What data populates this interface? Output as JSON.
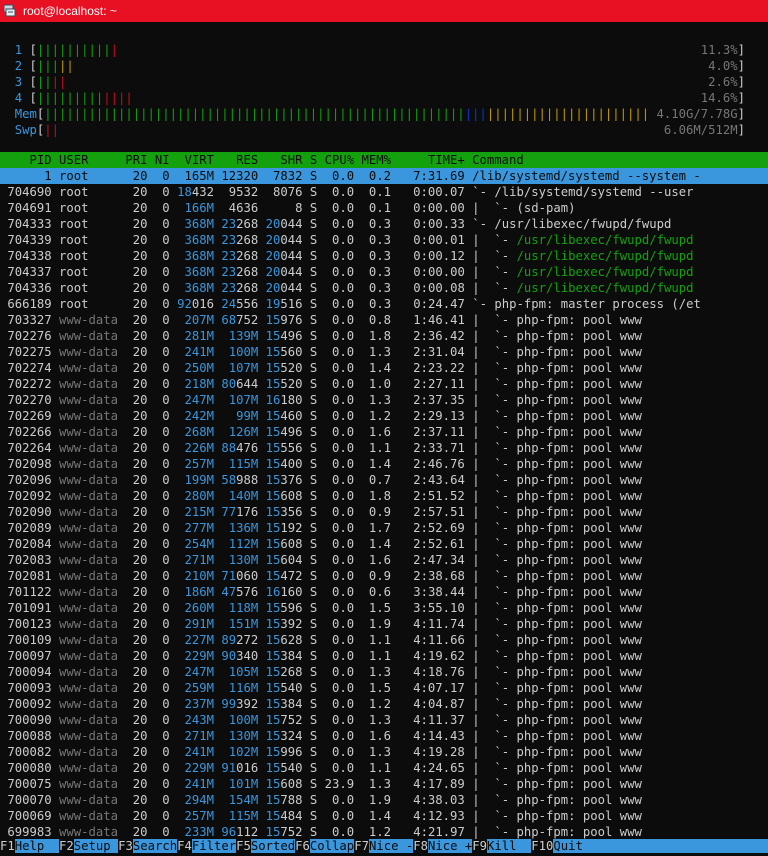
{
  "window": {
    "title": "root@localhost: ~"
  },
  "cpu_meters": [
    {
      "id": "1",
      "pct": "11.3%",
      "segs": [
        [
          "green",
          "||||||||||"
        ],
        [
          "red",
          "|"
        ]
      ]
    },
    {
      "id": "2",
      "pct": "4.0%",
      "segs": [
        [
          "green",
          "|||"
        ],
        [
          "yellow",
          "||"
        ]
      ]
    },
    {
      "id": "3",
      "pct": "2.6%",
      "segs": [
        [
          "green",
          "||"
        ],
        [
          "red",
          "||"
        ]
      ]
    },
    {
      "id": "4",
      "pct": "14.6%",
      "segs": [
        [
          "green",
          "|||||||||"
        ],
        [
          "red",
          "||||"
        ]
      ]
    }
  ],
  "mem_meter": {
    "label": "Mem",
    "value": "4.10G/7.78G"
  },
  "swp_meter": {
    "label": "Swp",
    "value": "6.06M/512M"
  },
  "columns": [
    "PID",
    "USER",
    "PRI",
    "NI",
    "VIRT",
    "RES",
    "SHR",
    "S",
    "CPU%",
    "MEM%",
    "TIME+",
    "Command"
  ],
  "processes": [
    {
      "pid": "1",
      "user": "root",
      "pri": "20",
      "ni": "0",
      "virt": "165M",
      "res": "12320",
      "shr": "7832",
      "s": "S",
      "cpu": "0.0",
      "mem": "0.2",
      "time": "7:31.69",
      "cmd": "/lib/systemd/systemd --system -"
    },
    {
      "pid": "704690",
      "user": "root",
      "pri": "20",
      "ni": "0",
      "virt": "18432",
      "res": "9532",
      "shr": "8076",
      "s": "S",
      "cpu": "0.0",
      "mem": "0.1",
      "time": "0:00.07",
      "cmd": "`- /lib/systemd/systemd --user"
    },
    {
      "pid": "704691",
      "user": "root",
      "pri": "20",
      "ni": "0",
      "virt": "166M",
      "res": "4636",
      "shr": "8",
      "s": "S",
      "cpu": "0.0",
      "mem": "0.1",
      "time": "0:00.00",
      "cmd": "|  `- (sd-pam)"
    },
    {
      "pid": "704333",
      "user": "root",
      "pri": "20",
      "ni": "0",
      "virt": "368M",
      "res": "23268",
      "shr": "20044",
      "s": "S",
      "cpu": "0.0",
      "mem": "0.3",
      "time": "0:00.33",
      "cmd": "`- /usr/libexec/fwupd/fwupd"
    },
    {
      "pid": "704339",
      "user": "root",
      "pri": "20",
      "ni": "0",
      "virt": "368M",
      "res": "23268",
      "shr": "20044",
      "s": "S",
      "cpu": "0.0",
      "mem": "0.3",
      "time": "0:00.01",
      "cmd": "|  `- /usr/libexec/fwupd/fwupd"
    },
    {
      "pid": "704338",
      "user": "root",
      "pri": "20",
      "ni": "0",
      "virt": "368M",
      "res": "23268",
      "shr": "20044",
      "s": "S",
      "cpu": "0.0",
      "mem": "0.3",
      "time": "0:00.12",
      "cmd": "|  `- /usr/libexec/fwupd/fwupd"
    },
    {
      "pid": "704337",
      "user": "root",
      "pri": "20",
      "ni": "0",
      "virt": "368M",
      "res": "23268",
      "shr": "20044",
      "s": "S",
      "cpu": "0.0",
      "mem": "0.3",
      "time": "0:00.00",
      "cmd": "|  `- /usr/libexec/fwupd/fwupd"
    },
    {
      "pid": "704336",
      "user": "root",
      "pri": "20",
      "ni": "0",
      "virt": "368M",
      "res": "23268",
      "shr": "20044",
      "s": "S",
      "cpu": "0.0",
      "mem": "0.3",
      "time": "0:00.08",
      "cmd": "|  `- /usr/libexec/fwupd/fwupd"
    },
    {
      "pid": "666189",
      "user": "root",
      "pri": "20",
      "ni": "0",
      "virt": "92016",
      "res": "24556",
      "shr": "19516",
      "s": "S",
      "cpu": "0.0",
      "mem": "0.3",
      "time": "0:24.47",
      "cmd": "`- php-fpm: master process (/et"
    },
    {
      "pid": "703327",
      "user": "www-data",
      "pri": "20",
      "ni": "0",
      "virt": "207M",
      "res": "68752",
      "shr": "15976",
      "s": "S",
      "cpu": "0.0",
      "mem": "0.8",
      "time": "1:46.41",
      "cmd": "|  `- php-fpm: pool www"
    },
    {
      "pid": "702276",
      "user": "www-data",
      "pri": "20",
      "ni": "0",
      "virt": "281M",
      "res": "139M",
      "shr": "15496",
      "s": "S",
      "cpu": "0.0",
      "mem": "1.8",
      "time": "2:36.42",
      "cmd": "|  `- php-fpm: pool www"
    },
    {
      "pid": "702275",
      "user": "www-data",
      "pri": "20",
      "ni": "0",
      "virt": "241M",
      "res": "100M",
      "shr": "15560",
      "s": "S",
      "cpu": "0.0",
      "mem": "1.3",
      "time": "2:31.04",
      "cmd": "|  `- php-fpm: pool www"
    },
    {
      "pid": "702274",
      "user": "www-data",
      "pri": "20",
      "ni": "0",
      "virt": "250M",
      "res": "107M",
      "shr": "15520",
      "s": "S",
      "cpu": "0.0",
      "mem": "1.4",
      "time": "2:23.22",
      "cmd": "|  `- php-fpm: pool www"
    },
    {
      "pid": "702272",
      "user": "www-data",
      "pri": "20",
      "ni": "0",
      "virt": "218M",
      "res": "80644",
      "shr": "15520",
      "s": "S",
      "cpu": "0.0",
      "mem": "1.0",
      "time": "2:27.11",
      "cmd": "|  `- php-fpm: pool www"
    },
    {
      "pid": "702270",
      "user": "www-data",
      "pri": "20",
      "ni": "0",
      "virt": "247M",
      "res": "107M",
      "shr": "16180",
      "s": "S",
      "cpu": "0.0",
      "mem": "1.3",
      "time": "2:37.35",
      "cmd": "|  `- php-fpm: pool www"
    },
    {
      "pid": "702269",
      "user": "www-data",
      "pri": "20",
      "ni": "0",
      "virt": "242M",
      "res": "99M",
      "shr": "15460",
      "s": "S",
      "cpu": "0.0",
      "mem": "1.2",
      "time": "2:29.13",
      "cmd": "|  `- php-fpm: pool www"
    },
    {
      "pid": "702266",
      "user": "www-data",
      "pri": "20",
      "ni": "0",
      "virt": "268M",
      "res": "126M",
      "shr": "15496",
      "s": "S",
      "cpu": "0.0",
      "mem": "1.6",
      "time": "2:37.11",
      "cmd": "|  `- php-fpm: pool www"
    },
    {
      "pid": "702264",
      "user": "www-data",
      "pri": "20",
      "ni": "0",
      "virt": "226M",
      "res": "88476",
      "shr": "15556",
      "s": "S",
      "cpu": "0.0",
      "mem": "1.1",
      "time": "2:33.71",
      "cmd": "|  `- php-fpm: pool www"
    },
    {
      "pid": "702098",
      "user": "www-data",
      "pri": "20",
      "ni": "0",
      "virt": "257M",
      "res": "115M",
      "shr": "15400",
      "s": "S",
      "cpu": "0.0",
      "mem": "1.4",
      "time": "2:46.76",
      "cmd": "|  `- php-fpm: pool www"
    },
    {
      "pid": "702096",
      "user": "www-data",
      "pri": "20",
      "ni": "0",
      "virt": "199M",
      "res": "58988",
      "shr": "15376",
      "s": "S",
      "cpu": "0.0",
      "mem": "0.7",
      "time": "2:43.64",
      "cmd": "|  `- php-fpm: pool www"
    },
    {
      "pid": "702092",
      "user": "www-data",
      "pri": "20",
      "ni": "0",
      "virt": "280M",
      "res": "140M",
      "shr": "15608",
      "s": "S",
      "cpu": "0.0",
      "mem": "1.8",
      "time": "2:51.52",
      "cmd": "|  `- php-fpm: pool www"
    },
    {
      "pid": "702090",
      "user": "www-data",
      "pri": "20",
      "ni": "0",
      "virt": "215M",
      "res": "77176",
      "shr": "15356",
      "s": "S",
      "cpu": "0.0",
      "mem": "0.9",
      "time": "2:57.51",
      "cmd": "|  `- php-fpm: pool www"
    },
    {
      "pid": "702089",
      "user": "www-data",
      "pri": "20",
      "ni": "0",
      "virt": "277M",
      "res": "136M",
      "shr": "15192",
      "s": "S",
      "cpu": "0.0",
      "mem": "1.7",
      "time": "2:52.69",
      "cmd": "|  `- php-fpm: pool www"
    },
    {
      "pid": "702084",
      "user": "www-data",
      "pri": "20",
      "ni": "0",
      "virt": "254M",
      "res": "112M",
      "shr": "15608",
      "s": "S",
      "cpu": "0.0",
      "mem": "1.4",
      "time": "2:52.61",
      "cmd": "|  `- php-fpm: pool www"
    },
    {
      "pid": "702083",
      "user": "www-data",
      "pri": "20",
      "ni": "0",
      "virt": "271M",
      "res": "130M",
      "shr": "15604",
      "s": "S",
      "cpu": "0.0",
      "mem": "1.6",
      "time": "2:47.34",
      "cmd": "|  `- php-fpm: pool www"
    },
    {
      "pid": "702081",
      "user": "www-data",
      "pri": "20",
      "ni": "0",
      "virt": "210M",
      "res": "71060",
      "shr": "15472",
      "s": "S",
      "cpu": "0.0",
      "mem": "0.9",
      "time": "2:38.68",
      "cmd": "|  `- php-fpm: pool www"
    },
    {
      "pid": "701122",
      "user": "www-data",
      "pri": "20",
      "ni": "0",
      "virt": "186M",
      "res": "47576",
      "shr": "16160",
      "s": "S",
      "cpu": "0.0",
      "mem": "0.6",
      "time": "3:38.44",
      "cmd": "|  `- php-fpm: pool www"
    },
    {
      "pid": "701091",
      "user": "www-data",
      "pri": "20",
      "ni": "0",
      "virt": "260M",
      "res": "118M",
      "shr": "15596",
      "s": "S",
      "cpu": "0.0",
      "mem": "1.5",
      "time": "3:55.10",
      "cmd": "|  `- php-fpm: pool www"
    },
    {
      "pid": "700123",
      "user": "www-data",
      "pri": "20",
      "ni": "0",
      "virt": "291M",
      "res": "151M",
      "shr": "15392",
      "s": "S",
      "cpu": "0.0",
      "mem": "1.9",
      "time": "4:11.74",
      "cmd": "|  `- php-fpm: pool www"
    },
    {
      "pid": "700109",
      "user": "www-data",
      "pri": "20",
      "ni": "0",
      "virt": "227M",
      "res": "89272",
      "shr": "15628",
      "s": "S",
      "cpu": "0.0",
      "mem": "1.1",
      "time": "4:11.66",
      "cmd": "|  `- php-fpm: pool www"
    },
    {
      "pid": "700097",
      "user": "www-data",
      "pri": "20",
      "ni": "0",
      "virt": "229M",
      "res": "90340",
      "shr": "15384",
      "s": "S",
      "cpu": "0.0",
      "mem": "1.1",
      "time": "4:19.62",
      "cmd": "|  `- php-fpm: pool www"
    },
    {
      "pid": "700094",
      "user": "www-data",
      "pri": "20",
      "ni": "0",
      "virt": "247M",
      "res": "105M",
      "shr": "15268",
      "s": "S",
      "cpu": "0.0",
      "mem": "1.3",
      "time": "4:18.76",
      "cmd": "|  `- php-fpm: pool www"
    },
    {
      "pid": "700093",
      "user": "www-data",
      "pri": "20",
      "ni": "0",
      "virt": "259M",
      "res": "116M",
      "shr": "15540",
      "s": "S",
      "cpu": "0.0",
      "mem": "1.5",
      "time": "4:07.17",
      "cmd": "|  `- php-fpm: pool www"
    },
    {
      "pid": "700092",
      "user": "www-data",
      "pri": "20",
      "ni": "0",
      "virt": "237M",
      "res": "99392",
      "shr": "15384",
      "s": "S",
      "cpu": "0.0",
      "mem": "1.2",
      "time": "4:04.87",
      "cmd": "|  `- php-fpm: pool www"
    },
    {
      "pid": "700090",
      "user": "www-data",
      "pri": "20",
      "ni": "0",
      "virt": "243M",
      "res": "100M",
      "shr": "15752",
      "s": "S",
      "cpu": "0.0",
      "mem": "1.3",
      "time": "4:11.37",
      "cmd": "|  `- php-fpm: pool www"
    },
    {
      "pid": "700088",
      "user": "www-data",
      "pri": "20",
      "ni": "0",
      "virt": "271M",
      "res": "130M",
      "shr": "15324",
      "s": "S",
      "cpu": "0.0",
      "mem": "1.6",
      "time": "4:14.43",
      "cmd": "|  `- php-fpm: pool www"
    },
    {
      "pid": "700082",
      "user": "www-data",
      "pri": "20",
      "ni": "0",
      "virt": "241M",
      "res": "102M",
      "shr": "15996",
      "s": "S",
      "cpu": "0.0",
      "mem": "1.3",
      "time": "4:19.28",
      "cmd": "|  `- php-fpm: pool www"
    },
    {
      "pid": "700080",
      "user": "www-data",
      "pri": "20",
      "ni": "0",
      "virt": "229M",
      "res": "91016",
      "shr": "15540",
      "s": "S",
      "cpu": "0.0",
      "mem": "1.1",
      "time": "4:24.65",
      "cmd": "|  `- php-fpm: pool www"
    },
    {
      "pid": "700075",
      "user": "www-data",
      "pri": "20",
      "ni": "0",
      "virt": "241M",
      "res": "101M",
      "shr": "15608",
      "s": "S",
      "cpu": "23.9",
      "mem": "1.3",
      "time": "4:17.89",
      "cmd": "|  `- php-fpm: pool www"
    },
    {
      "pid": "700070",
      "user": "www-data",
      "pri": "20",
      "ni": "0",
      "virt": "294M",
      "res": "154M",
      "shr": "15788",
      "s": "S",
      "cpu": "0.0",
      "mem": "1.9",
      "time": "4:38.03",
      "cmd": "|  `- php-fpm: pool www"
    },
    {
      "pid": "700069",
      "user": "www-data",
      "pri": "20",
      "ni": "0",
      "virt": "257M",
      "res": "115M",
      "shr": "15484",
      "s": "S",
      "cpu": "0.0",
      "mem": "1.4",
      "time": "4:12.93",
      "cmd": "|  `- php-fpm: pool www"
    },
    {
      "pid": "699983",
      "user": "www-data",
      "pri": "20",
      "ni": "0",
      "virt": "233M",
      "res": "96112",
      "shr": "15752",
      "s": "S",
      "cpu": "0.0",
      "mem": "1.2",
      "time": "4:21.97",
      "cmd": "|  `- php-fpm: pool www"
    }
  ],
  "fkeys": [
    {
      "key": "F1",
      "label": "Help  "
    },
    {
      "key": "F2",
      "label": "Setup "
    },
    {
      "key": "F3",
      "label": "Search"
    },
    {
      "key": "F4",
      "label": "Filter"
    },
    {
      "key": "F5",
      "label": "Sorted"
    },
    {
      "key": "F6",
      "label": "Collap"
    },
    {
      "key": "F7",
      "label": "Nice -"
    },
    {
      "key": "F8",
      "label": "Nice +"
    },
    {
      "key": "F9",
      "label": "Kill  "
    },
    {
      "key": "F10",
      "label": "Quit  "
    }
  ],
  "colors": {
    "title_bar": "#e81123",
    "header_bar": "#13a10e",
    "selected_row": "#3a96dd"
  }
}
